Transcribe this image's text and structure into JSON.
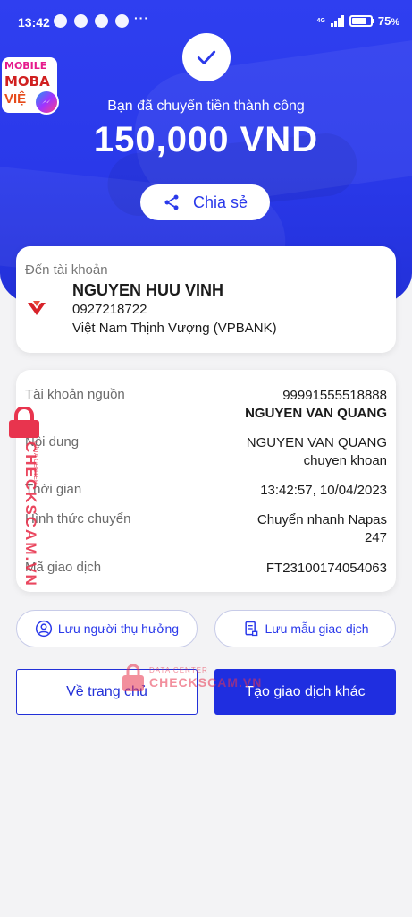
{
  "statusbar": {
    "time": "13:42",
    "battery": "75",
    "network": "4G",
    "dots": "···"
  },
  "logo": {
    "line1": "MOBILE",
    "line2": "MOBA",
    "line3": "VIỆ"
  },
  "hero": {
    "success_text": "Bạn đã chuyển tiền thành công",
    "amount": "150,000 VND",
    "share_label": "Chia sẻ"
  },
  "destination": {
    "label": "Đến tài khoản",
    "name": "NGUYEN HUU VINH",
    "phone": "0927218722",
    "bank": "Việt Nam Thịnh Vượng (VPBANK)"
  },
  "details": [
    {
      "key": "Tài khoản nguồn",
      "value_line1": "99991555518888",
      "value_line2": "NGUYEN VAN QUANG"
    },
    {
      "key": "Nội dung",
      "value_line1": "NGUYEN VAN QUANG",
      "value_line2": "chuyen khoan"
    },
    {
      "key": "Thời gian",
      "value_line1": "13:42:57, 10/04/2023",
      "value_line2": ""
    },
    {
      "key": "Hình thức chuyển",
      "value_line1": "Chuyển nhanh Napas",
      "value_line2": "247"
    },
    {
      "key": "Mã giao dịch",
      "value_line1": "FT23100174054063",
      "value_line2": ""
    }
  ],
  "actions": {
    "save_beneficiary": "Lưu người thụ hưởng",
    "save_template": "Lưu mẫu giao dịch",
    "home": "Về trang chủ",
    "new_transaction": "Tạo giao dịch khác"
  },
  "watermark": {
    "side": "CHECKSCAM.VN",
    "side_small": "DATA CENTER",
    "center_small": "DATA CENTER",
    "center": "CHECKSCAM.VN"
  },
  "colors": {
    "primary": "#2a39ea",
    "watermark": "#e8344e"
  }
}
